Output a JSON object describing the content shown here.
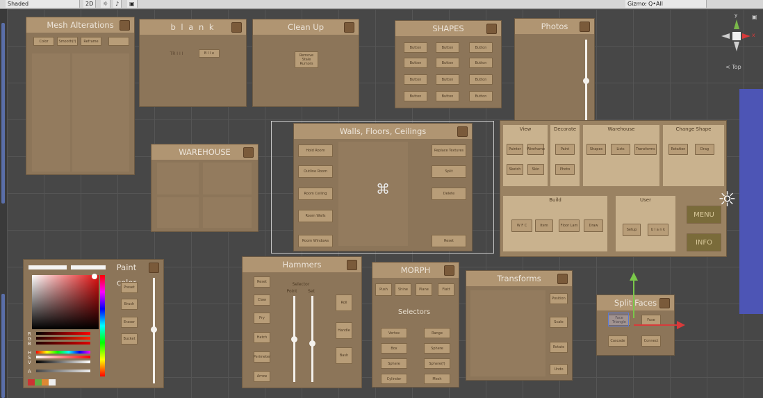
{
  "toolbar": {
    "shading": "Shaded",
    "mode2d": "2D",
    "gizmos": "Gizmos",
    "search": "Q•All"
  },
  "gizmo": {
    "top_label": "< Top",
    "y_axis": "y",
    "x_axis": "x"
  },
  "panels": {
    "mesh": {
      "title": "Mesh Alterations",
      "buttons": [
        "Color",
        "Smooth(f)",
        "Reframe",
        ""
      ]
    },
    "blank": {
      "title": "b l a n k",
      "left_text": "TR I I I",
      "button": "B I I e"
    },
    "cleanup": {
      "title": "Clean Up",
      "button": "Remove Stale Rumors"
    },
    "shapes": {
      "title": "SHAPES",
      "buttons": [
        "Button",
        "Button",
        "Button",
        "Button",
        "Button",
        "Button",
        "Button",
        "Button",
        "Button",
        "Button",
        "Button",
        "Button"
      ]
    },
    "photos": {
      "title": "Photos"
    },
    "warehouse": {
      "title": "WAREHOUSE"
    },
    "walls": {
      "title": "Walls, Floors, Ceilings",
      "left_buttons": [
        "Hold Room",
        "Outline Room",
        "Room Ceiling",
        "Room Walls",
        "Room Windows"
      ],
      "right_buttons": [
        "Replace Textures",
        "Split",
        "Delete",
        "Reset"
      ]
    },
    "menu": {
      "view": {
        "title": "View",
        "buttons": [
          "Painter",
          "Wireframe",
          "Sketch",
          "Skin"
        ]
      },
      "decorate": {
        "title": "Decorate",
        "buttons": [
          "Paint",
          "Photo"
        ]
      },
      "warehouse": {
        "title": "Warehouse",
        "buttons": [
          "Shapes",
          "Lists",
          "Transforms"
        ]
      },
      "changeshape": {
        "title": "Change Shape",
        "buttons": [
          "Rotation",
          "Drag"
        ]
      },
      "build": {
        "title": "Build",
        "buttons": [
          "W F C",
          "Item",
          "Floor Lam",
          "Draw"
        ]
      },
      "user": {
        "title": "User",
        "buttons": [
          "Setup",
          "b l a n k"
        ]
      },
      "menu_button": "MENU",
      "info_button": "INFO"
    },
    "paint": {
      "title": "Paint color",
      "buttons": [
        "Preset",
        "Brush",
        "Eraser",
        "Bucket"
      ],
      "rows": [
        "R",
        "G",
        "B",
        "H",
        "S",
        "V",
        "A"
      ]
    },
    "hammers": {
      "title": "Hammers",
      "left_buttons": [
        "Reset",
        "Claw",
        "Pry",
        "Hatch",
        "Perimeter",
        "Arrow"
      ],
      "selector_label": "Selector",
      "col_labels": [
        "Point",
        "Set"
      ],
      "right_buttons": [
        "Roll",
        "Handle",
        "Bash"
      ]
    },
    "morph": {
      "title": "MORPH",
      "top_buttons": [
        "Push",
        "Shine",
        "Plane",
        "Flatt"
      ],
      "selectors_label": "Selectors",
      "buttons": [
        "Vertex",
        "Range",
        "Box",
        "Sphere",
        "Sphere",
        "Sphere(f)",
        "Cylinder",
        "Mesh"
      ]
    },
    "transforms": {
      "title": "Transforms",
      "buttons": [
        "Position",
        "Scale",
        "Rotate",
        "Undo"
      ]
    },
    "split": {
      "title": "Split Faces",
      "buttons": [
        "Face Triangle",
        "Fuse",
        "Cascade",
        "Connect"
      ]
    }
  }
}
